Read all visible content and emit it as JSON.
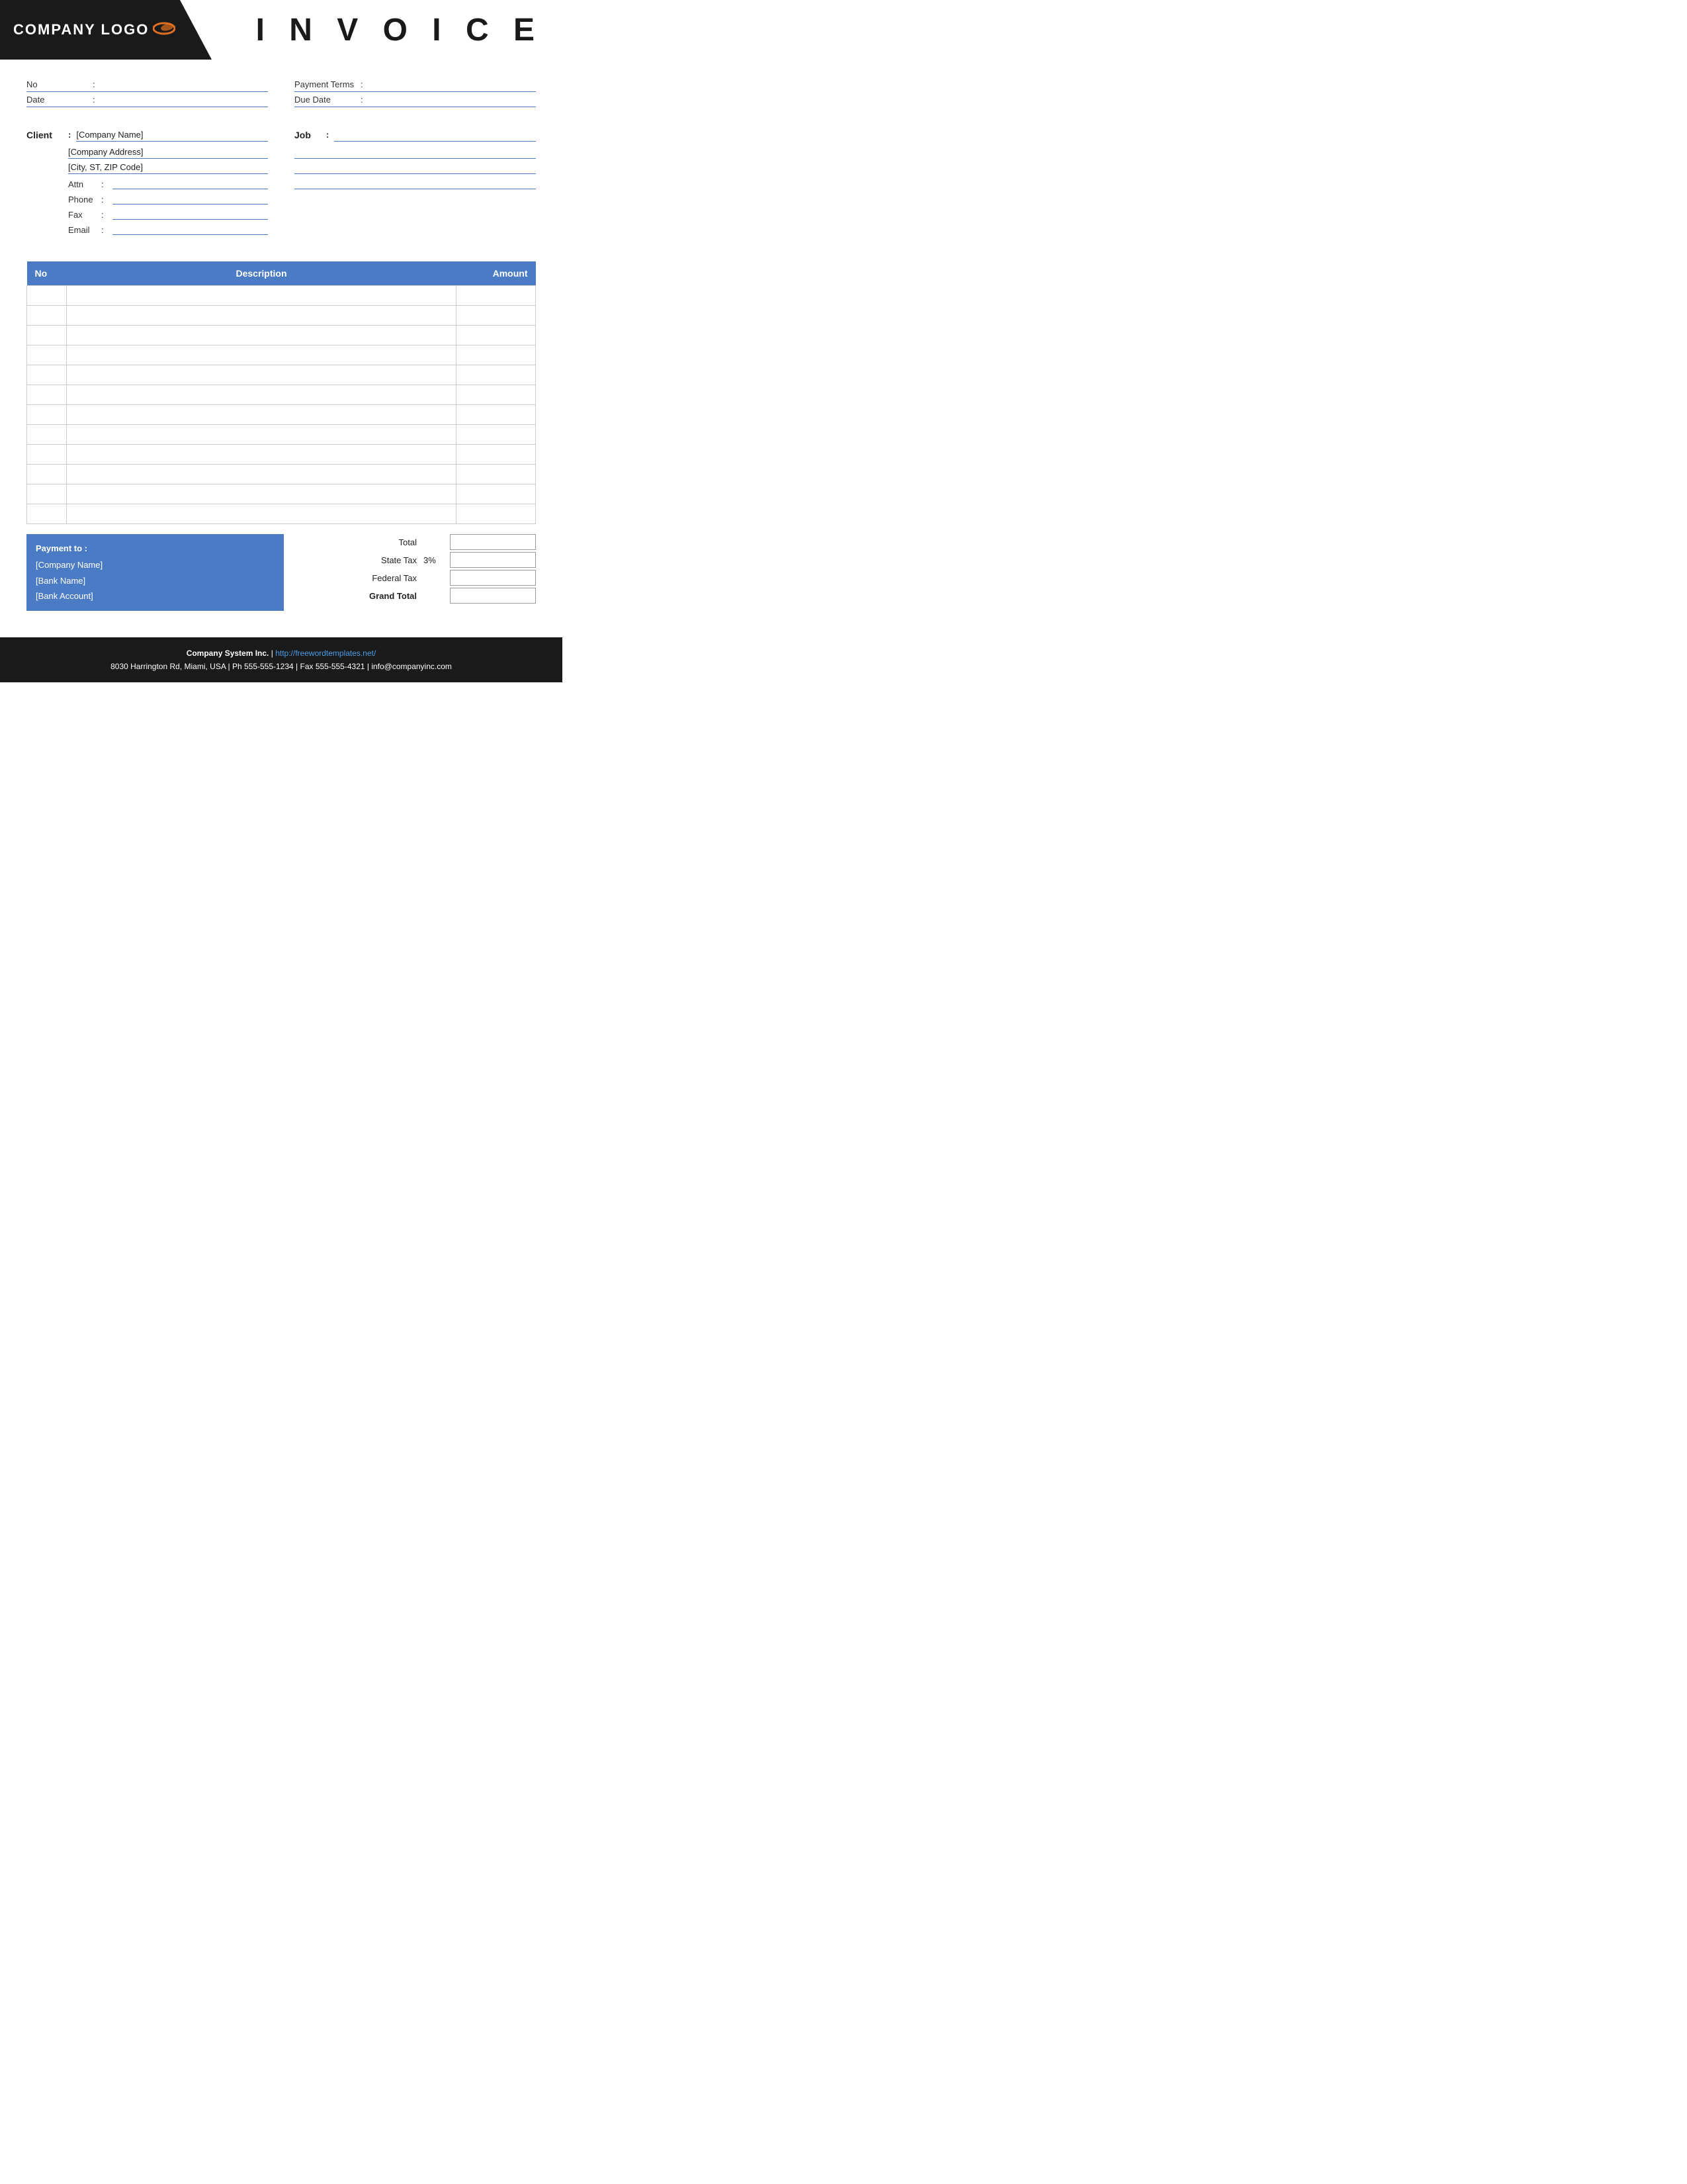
{
  "header": {
    "logo_text": "COMPANY LOGO",
    "invoice_title": "I N V O I C E"
  },
  "info": {
    "no_label": "No",
    "no_colon": ":",
    "no_value": "",
    "date_label": "Date",
    "date_colon": ":",
    "date_value": "",
    "payment_terms_label": "Payment  Terms",
    "payment_terms_colon": ":",
    "payment_terms_value": "",
    "due_date_label": "Due Date",
    "due_date_colon": ":",
    "due_date_value": ""
  },
  "client": {
    "label": "Client",
    "colon": ":",
    "company_name": "[Company Name]",
    "company_address": "[Company Address]",
    "city_st_zip": "[City, ST, ZIP Code]",
    "attn_label": "Attn",
    "attn_colon": ":",
    "attn_value": "",
    "phone_label": "Phone",
    "phone_colon": ":",
    "phone_value": "",
    "fax_label": "Fax",
    "fax_colon": ":",
    "fax_value": "",
    "email_label": "Email",
    "email_colon": ":",
    "email_value": ""
  },
  "job": {
    "label": "Job",
    "colon": ":",
    "line1": "",
    "line2": "",
    "line3": "",
    "line4": ""
  },
  "table": {
    "col_no": "No",
    "col_description": "Description",
    "col_amount": "Amount",
    "rows": [
      {
        "no": "",
        "description": "",
        "amount": ""
      },
      {
        "no": "",
        "description": "",
        "amount": ""
      },
      {
        "no": "",
        "description": "",
        "amount": ""
      },
      {
        "no": "",
        "description": "",
        "amount": ""
      },
      {
        "no": "",
        "description": "",
        "amount": ""
      },
      {
        "no": "",
        "description": "",
        "amount": ""
      },
      {
        "no": "",
        "description": "",
        "amount": ""
      },
      {
        "no": "",
        "description": "",
        "amount": ""
      },
      {
        "no": "",
        "description": "",
        "amount": ""
      },
      {
        "no": "",
        "description": "",
        "amount": ""
      },
      {
        "no": "",
        "description": "",
        "amount": ""
      },
      {
        "no": "",
        "description": "",
        "amount": ""
      }
    ]
  },
  "payment": {
    "title": "Payment to :",
    "company_name": "[Company Name]",
    "bank_name": "[Bank Name]",
    "bank_account": "[Bank Account]"
  },
  "totals": {
    "total_label": "Total",
    "total_value": "",
    "state_tax_label": "State Tax",
    "state_tax_percent": "3%",
    "state_tax_value": "",
    "federal_tax_label": "Federal Tax",
    "federal_tax_value": "",
    "grand_total_label": "Grand Total",
    "grand_total_value": ""
  },
  "footer": {
    "company": "Company System Inc.",
    "separator": "|",
    "website": "http://freewordtemplates.net/",
    "address": "8030 Harrington Rd, Miami, USA | Ph 555-555-1234 | Fax 555-555-4321 | info@companyinc.com"
  }
}
